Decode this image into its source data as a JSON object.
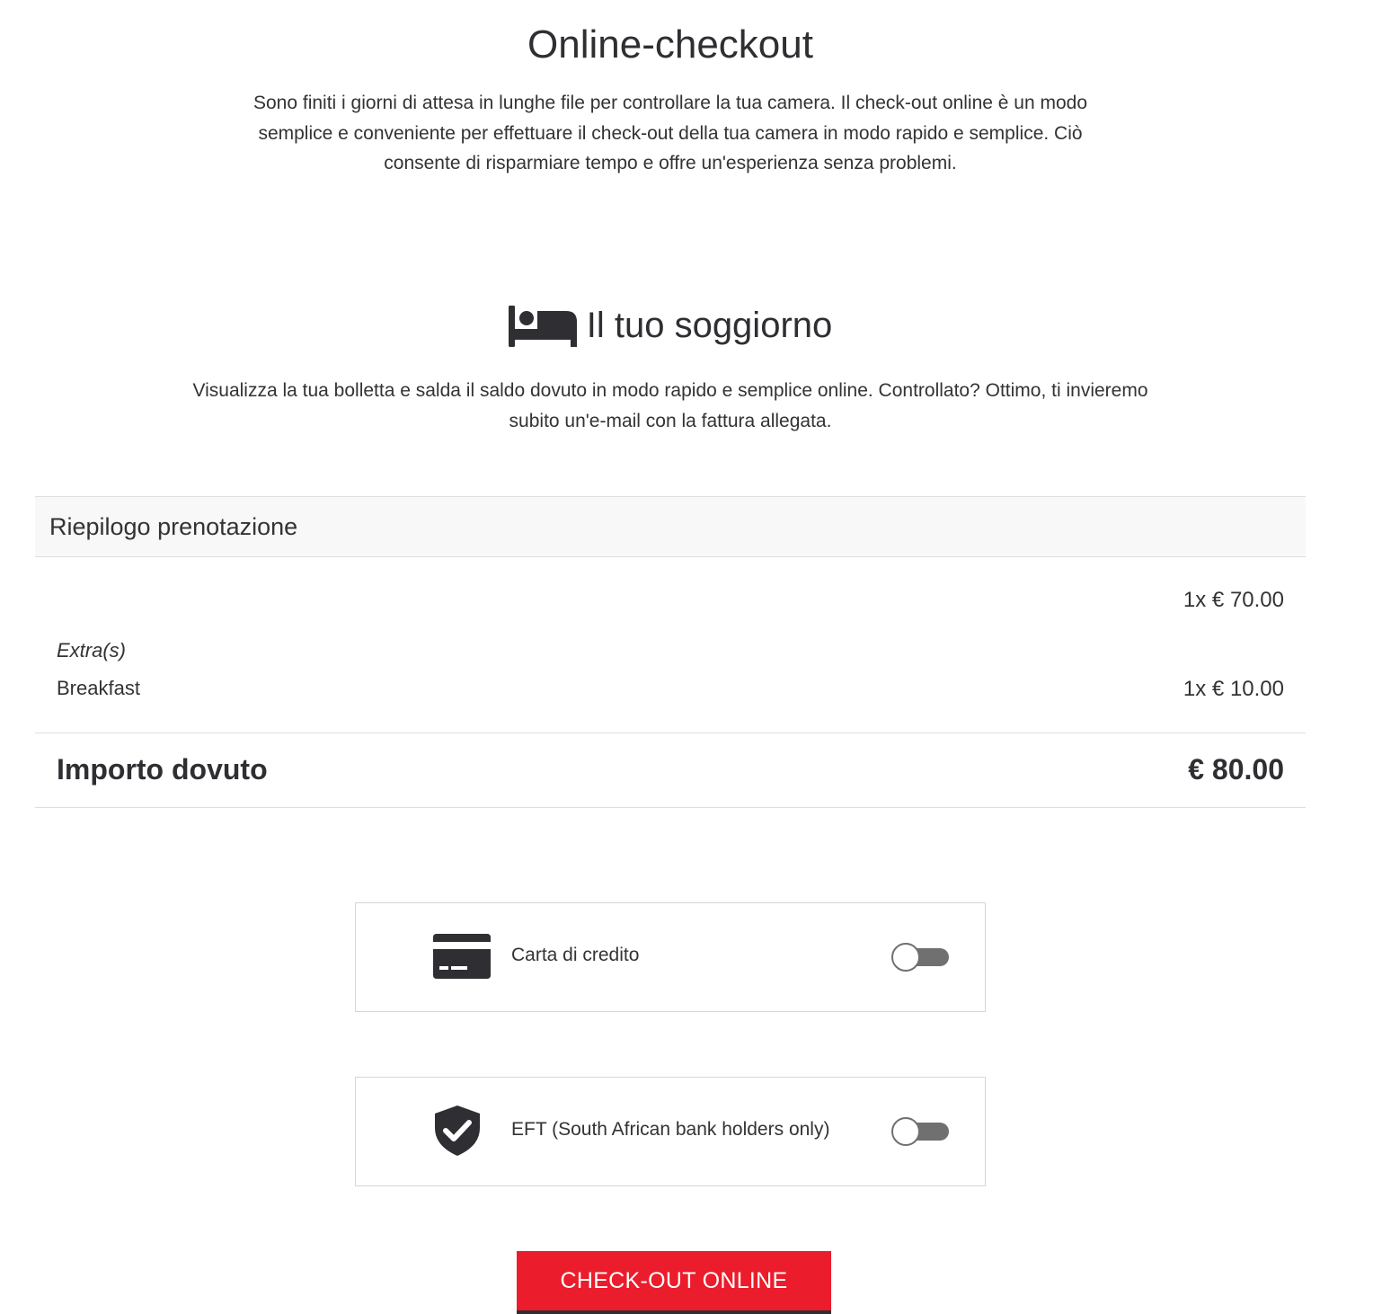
{
  "hero": {
    "title": "Online-checkout",
    "description": "Sono finiti i giorni di attesa in lunghe file per controllare la tua camera. Il check-out online è un modo semplice e conveniente per effettuare il check-out della tua camera in modo rapido e semplice. Ciò consente di risparmiare tempo e offre un'esperienza senza problemi."
  },
  "stay": {
    "icon": "bed-icon",
    "title": "Il tuo soggiorno",
    "description": "Visualizza la tua bolletta e salda il saldo dovuto in modo rapido e semplice online. Controllato? Ottimo, ti invieremo subito un'e-mail con la fattura allegata."
  },
  "summary": {
    "header": "Riepilogo prenotazione",
    "room_price": "1x € 70.00",
    "extras_label": "Extra(s)",
    "extras": [
      {
        "name": "Breakfast",
        "price": "1x € 10.00"
      }
    ],
    "total_label": "Importo dovuto",
    "total_value": "€ 80.00"
  },
  "payment_methods": [
    {
      "icon": "credit-card-icon",
      "label": "Carta di credito",
      "enabled": false
    },
    {
      "icon": "shield-check-icon",
      "label": "EFT (South African bank holders only)",
      "enabled": false
    }
  ],
  "checkout_button": "CHECK-OUT ONLINE",
  "colors": {
    "primary_button": "#eb1c2b",
    "text_dark": "#2f2f33",
    "toggle_off": "#707070"
  }
}
